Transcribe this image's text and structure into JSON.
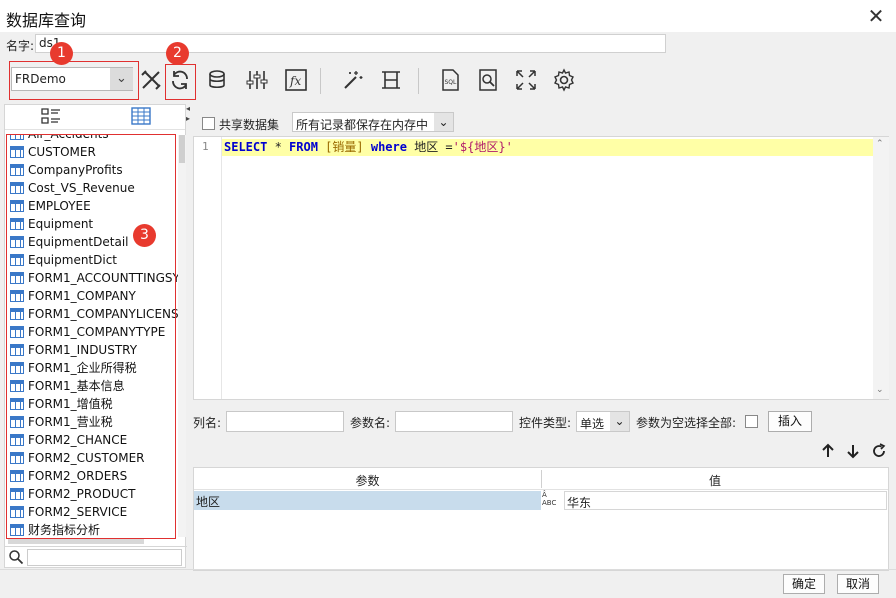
{
  "window": {
    "title": "数据库查询",
    "close_glyph": "✕"
  },
  "name_field": {
    "label": "名字:",
    "value": "ds1"
  },
  "connection": {
    "selected": "FRDemo"
  },
  "badges": [
    "1",
    "2",
    "3"
  ],
  "toolbar_icons": [
    "tools-icon",
    "refresh-icon",
    "database-sql-icon",
    "filter-sliders-icon",
    "formula-icon",
    "magic-wand-icon",
    "columns-icon",
    "sql-file-icon",
    "preview-icon",
    "fullscreen-icon",
    "settings-gear-icon"
  ],
  "left_panel": {
    "tables": [
      "Air_Accidents",
      "CUSTOMER",
      "CompanyProfits",
      "Cost_VS_Revenue",
      "EMPLOYEE",
      "Equipment",
      "EquipmentDetail",
      "EquipmentDict",
      "FORM1_ACCOUNTTINGSY",
      "FORM1_COMPANY",
      "FORM1_COMPANYLICENS",
      "FORM1_COMPANYTYPE",
      "FORM1_INDUSTRY",
      "FORM1_企业所得税",
      "FORM1_基本信息",
      "FORM1_增值税",
      "FORM1_营业税",
      "FORM2_CHANCE",
      "FORM2_CUSTOMER",
      "FORM2_ORDERS",
      "FORM2_PRODUCT",
      "FORM2_SERVICE",
      "财务指标分析"
    ]
  },
  "share": {
    "label": "共享数据集",
    "checked": false,
    "cache_mode": "所有记录都保存在内存中"
  },
  "editor": {
    "line_number": "1",
    "sql": {
      "t1": "SELECT",
      "t2": " * ",
      "t3": "FROM",
      "t4": " [销量] ",
      "t5": "where",
      "t6": " 地区 =",
      "t7": "'${地区}'"
    }
  },
  "param_row": {
    "col_label": "列名:",
    "param_label": "参数名:",
    "control_label": "控件类型:",
    "control_value": "单选",
    "select_all_label": "参数为空选择全部:",
    "insert_button": "插入"
  },
  "params_table": {
    "headers": [
      "参数",
      "值"
    ],
    "rows": [
      {
        "name": "地区",
        "value": "华东"
      }
    ]
  },
  "footer": {
    "ok": "确定",
    "cancel": "取消"
  },
  "colors": {
    "highlight": "#ffffa6",
    "selected_row": "#c8dcec",
    "badge": "#e83a2e",
    "redbox": "#e03030"
  }
}
